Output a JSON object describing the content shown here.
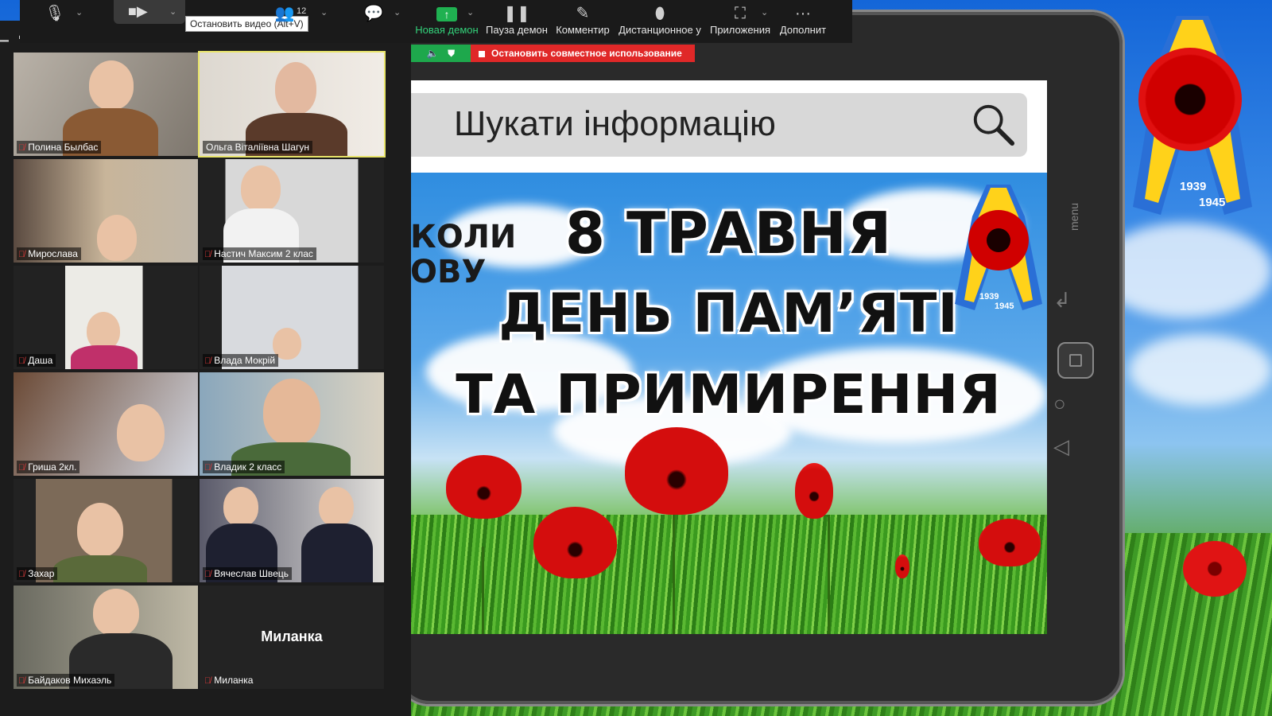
{
  "toolbar": {
    "mic_caret": "⌄",
    "participants_count": "12",
    "tooltip": "Остановить видео (Alt+V)",
    "tools": [
      {
        "label": "Новая демон",
        "icon": "share-screen-icon"
      },
      {
        "label": "Пауза демон",
        "icon": "pause-icon"
      },
      {
        "label": "Комментир",
        "icon": "pen-icon"
      },
      {
        "label": "Дистанционное у",
        "icon": "mouse-icon"
      },
      {
        "label": "Приложения",
        "icon": "apps-icon"
      },
      {
        "label": "Дополнит",
        "icon": "more-icon"
      }
    ]
  },
  "share_bar": {
    "stop_label": "Остановить совместное использование"
  },
  "gallery": {
    "participants": [
      {
        "name": "Полина Былбас",
        "muted": true
      },
      {
        "name": "Ольга Віталіївна Шагун",
        "muted": false,
        "active": true
      },
      {
        "name": "Мирослава",
        "muted": true
      },
      {
        "name": "Настич Максим 2 клас",
        "muted": true
      },
      {
        "name": "Даша",
        "muted": true
      },
      {
        "name": "Влада Мокрій",
        "muted": true
      },
      {
        "name": "Гриша 2кл.",
        "muted": true
      },
      {
        "name": "Владик 2 класс",
        "muted": true
      },
      {
        "name": "Захар",
        "muted": true
      },
      {
        "name": "Вячеслав Швець",
        "muted": true
      },
      {
        "name": "Байдаков Михаэль",
        "muted": true
      },
      {
        "name": "Миланка",
        "muted": true,
        "no_video_name": "Миланка"
      }
    ]
  },
  "slide": {
    "search_text": "Шукати інформацію",
    "title_lines": [
      "8 ТРАВНЯ",
      "ДЕНЬ ПАМ’ЯТІ",
      "ТА ПРИМИРЕННЯ"
    ],
    "side_text": [
      "КОЛИ",
      "ОВУ"
    ],
    "years": [
      "1939",
      "1945"
    ]
  },
  "tablet": {
    "menu_label": "menu"
  },
  "desktop": {
    "years": [
      "1939",
      "1945"
    ]
  },
  "colors": {
    "share_green": "#1ea84c",
    "stop_red": "#e02828",
    "active_outline": "#e8e46a",
    "mute_red": "#e23b3b"
  }
}
